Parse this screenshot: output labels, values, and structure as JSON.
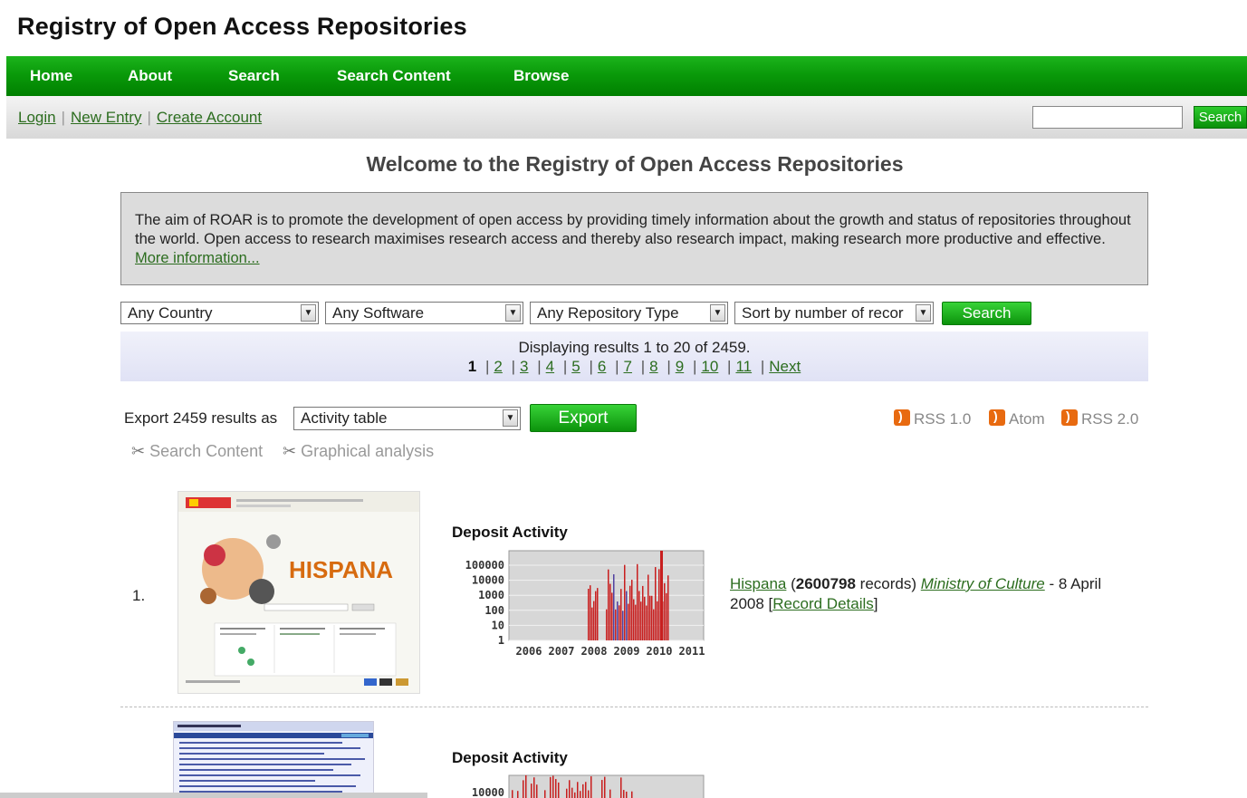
{
  "site_title": "Registry of Open Access Repositories",
  "nav": [
    "Home",
    "About",
    "Search",
    "Search Content",
    "Browse"
  ],
  "subnav": {
    "login": "Login",
    "new_entry": "New Entry",
    "create_account": "Create Account",
    "search_button": "Search",
    "search_value": ""
  },
  "welcome": "Welcome to the Registry of Open Access Repositories",
  "aim": {
    "text": "The aim of ROAR is to promote the development of open access by providing timely information about the growth and status of repositories throughout the world. Open access to research maximises research access and thereby also research impact, making research more productive and effective. ",
    "link": "More information..."
  },
  "filters": {
    "country": "Any Country",
    "software": "Any Software",
    "repo_type": "Any Repository Type",
    "sort": "Sort by number of recor",
    "search_button": "Search"
  },
  "results": {
    "summary": "Displaying results 1 to 20 of 2459.",
    "current_page": "1",
    "pages": [
      "2",
      "3",
      "4",
      "5",
      "6",
      "7",
      "8",
      "9",
      "10",
      "11"
    ],
    "next": "Next"
  },
  "export": {
    "label": "Export 2459 results as",
    "format": "Activity table",
    "button": "Export"
  },
  "feeds": [
    "RSS 1.0",
    "Atom",
    "RSS 2.0"
  ],
  "tools": [
    "Search Content",
    "Graphical analysis"
  ],
  "entries": [
    {
      "number": "1.",
      "deposit_title": "Deposit Activity",
      "name": "Hispana",
      "records": "2600798",
      "records_suffix": " records) ",
      "org": "Ministry of Culture",
      "date": " - 8 April 2008 [",
      "details": "Record Details",
      "close": "]",
      "thumb_text": "HISPANA",
      "chart": {
        "y_ticks": [
          "100000",
          "10000",
          "1000",
          "100",
          "10",
          "1"
        ],
        "x_ticks": [
          "2006",
          "2007",
          "2008",
          "2009",
          "2010",
          "2011"
        ]
      }
    },
    {
      "deposit_title": "Deposit Activity",
      "chart": {
        "y_ticks": [
          "10000"
        ]
      }
    }
  ]
}
